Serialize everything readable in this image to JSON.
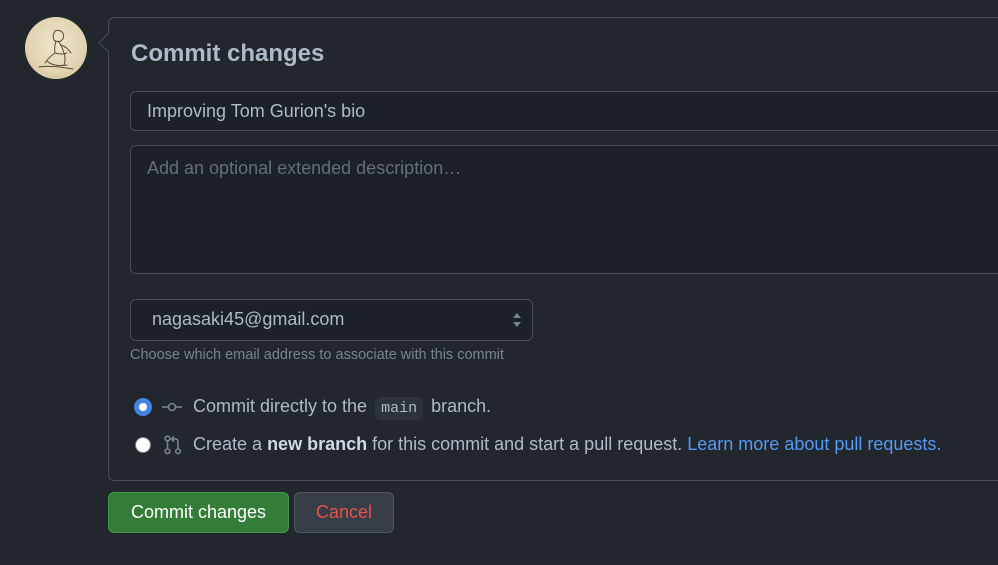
{
  "form": {
    "title": "Commit changes",
    "summary_value": "Improving Tom Gurion's bio",
    "description_placeholder": "Add an optional extended description…",
    "email_selected": "nagasaki45@gmail.com",
    "email_hint": "Choose which email address to associate with this commit"
  },
  "options": {
    "direct": {
      "before": "Commit directly to the",
      "branch": "main",
      "after": "branch.",
      "selected": true
    },
    "new_branch": {
      "before": "Create a",
      "bold": "new branch",
      "after": "for this commit and start a pull request.",
      "link": "Learn more about pull requests.",
      "selected": false
    }
  },
  "buttons": {
    "commit_label": "Commit changes",
    "cancel_label": "Cancel"
  },
  "icons": {
    "avatar": "user-avatar",
    "commit": "git-commit-icon",
    "pull_request": "git-pull-request-icon",
    "select": "select-arrows-icon"
  },
  "colors": {
    "background": "#22272e",
    "primary_button": "#347d39",
    "danger_text": "#e5534b",
    "link": "#539bf5",
    "radio_accent": "#4184e4"
  }
}
